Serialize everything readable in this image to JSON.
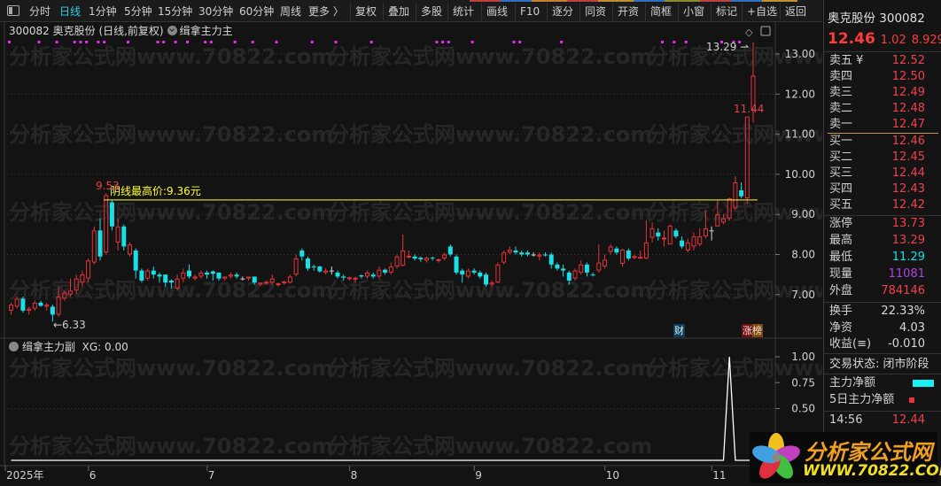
{
  "toolbar": {
    "periods": [
      "分时",
      "日线",
      "1分钟",
      "5分钟",
      "15分钟",
      "30分钟",
      "60分钟",
      "周线",
      "更多 〉"
    ],
    "active_period": "日线",
    "buttons": [
      "复权",
      "叠加",
      "多股",
      "统计",
      "画线",
      "F10",
      "逐分",
      "同资",
      "开资",
      "简框",
      "小窗",
      "标记",
      "+自选",
      "返回"
    ]
  },
  "chart_info": {
    "title": "300082 奥克股份 (日线,前复权)",
    "indicator": "缉拿主力主"
  },
  "indicator_panel": {
    "name": "缉拿主力副",
    "readout": "XG: 0.00"
  },
  "watermark": "分析家公式网www.70822.com",
  "badges": {
    "finance": "财",
    "limit_up_list": "涨榜"
  },
  "annotations": {
    "high_label": "9.53",
    "low_label": "6.33",
    "peak_label": "13.29",
    "last_open_label": "11.44",
    "bear_high_line_label": "阴线最高价:9.36元"
  },
  "colors": {
    "up": "#e8323c",
    "down": "#19e0e6",
    "flat": "#d8d8d8",
    "line": "#ffff33",
    "marker": "#e030e8",
    "bg": "#131313"
  },
  "chart_data": [
    {
      "type": "candlestick",
      "title": "300082 奥克股份 (日线,前复权)",
      "yticks": [
        "13.00",
        "12.00",
        "11.00",
        "10.00",
        "9.00",
        "8.00",
        "7.00"
      ],
      "ylim": [
        6.0,
        13.5
      ],
      "xticks": [
        {
          "label": "2025年",
          "index": 0
        },
        {
          "label": "6",
          "index": 14
        },
        {
          "label": "7",
          "index": 34
        },
        {
          "label": "8",
          "index": 58
        },
        {
          "label": "9",
          "index": 79
        },
        {
          "label": "10",
          "index": 101
        },
        {
          "label": "11",
          "index": 119
        }
      ],
      "hline": {
        "value": 9.36,
        "start_index": 16
      },
      "top_markers": [
        0,
        5,
        8,
        11,
        12,
        13,
        15,
        16,
        20,
        25,
        26,
        28,
        30,
        33,
        34,
        38,
        41,
        45,
        51,
        55,
        61,
        72,
        73,
        74,
        78,
        85,
        86,
        93,
        110,
        112,
        114,
        120,
        122,
        123
      ],
      "candles": [
        [
          6.6,
          6.8,
          6.5,
          6.75
        ],
        [
          6.7,
          6.95,
          6.65,
          6.9
        ],
        [
          6.9,
          6.95,
          6.55,
          6.6
        ],
        [
          6.6,
          6.7,
          6.5,
          6.65
        ],
        [
          6.65,
          6.85,
          6.6,
          6.8
        ],
        [
          6.8,
          6.85,
          6.7,
          6.72
        ],
        [
          6.7,
          6.8,
          6.6,
          6.75
        ],
        [
          6.7,
          6.75,
          6.33,
          6.5
        ],
        [
          6.5,
          7.2,
          6.45,
          6.95
        ],
        [
          6.9,
          7.1,
          6.85,
          7.05
        ],
        [
          7.0,
          7.4,
          6.95,
          7.1
        ],
        [
          7.1,
          7.5,
          7.0,
          7.4
        ],
        [
          7.3,
          7.6,
          7.2,
          7.5
        ],
        [
          7.4,
          7.9,
          7.3,
          7.85
        ],
        [
          7.8,
          8.7,
          7.75,
          8.6
        ],
        [
          8.6,
          8.9,
          7.85,
          7.95
        ],
        [
          8.05,
          9.53,
          8.0,
          9.48
        ],
        [
          9.3,
          9.36,
          8.6,
          8.7
        ],
        [
          8.3,
          8.9,
          8.1,
          8.7
        ],
        [
          8.7,
          8.75,
          8.1,
          8.2
        ],
        [
          8.0,
          8.3,
          7.95,
          8.25
        ],
        [
          8.1,
          8.15,
          7.4,
          7.6
        ],
        [
          7.6,
          7.65,
          7.3,
          7.35
        ],
        [
          7.4,
          7.65,
          7.35,
          7.6
        ],
        [
          7.6,
          7.7,
          7.4,
          7.5
        ],
        [
          7.5,
          7.55,
          7.3,
          7.45
        ],
        [
          7.5,
          7.5,
          7.2,
          7.3
        ],
        [
          7.35,
          7.38,
          7.15,
          7.3
        ],
        [
          7.15,
          7.5,
          7.1,
          7.4
        ],
        [
          7.4,
          7.65,
          7.3,
          7.55
        ],
        [
          7.6,
          7.75,
          7.4,
          7.45
        ],
        [
          7.4,
          7.5,
          7.35,
          7.45
        ],
        [
          7.45,
          7.6,
          7.4,
          7.55
        ],
        [
          7.55,
          7.6,
          7.4,
          7.5
        ],
        [
          7.58,
          7.6,
          7.35,
          7.52
        ],
        [
          7.55,
          7.55,
          7.35,
          7.4
        ],
        [
          7.4,
          7.45,
          7.35,
          7.45
        ],
        [
          7.45,
          7.55,
          7.4,
          7.5
        ],
        [
          7.5,
          7.55,
          7.4,
          7.45
        ],
        [
          7.4,
          7.45,
          7.35,
          7.4
        ],
        [
          7.4,
          7.45,
          7.35,
          7.45
        ],
        [
          7.45,
          7.45,
          7.25,
          7.3
        ],
        [
          7.25,
          7.3,
          7.2,
          7.3
        ],
        [
          7.3,
          7.35,
          7.25,
          7.32
        ],
        [
          7.3,
          7.5,
          7.25,
          7.4
        ],
        [
          7.25,
          7.3,
          7.2,
          7.28
        ],
        [
          7.28,
          7.35,
          7.25,
          7.33
        ],
        [
          7.3,
          7.5,
          7.28,
          7.45
        ],
        [
          7.5,
          8.0,
          7.45,
          7.9
        ],
        [
          8.1,
          8.15,
          7.85,
          7.95
        ],
        [
          7.9,
          7.95,
          7.6,
          7.65
        ],
        [
          7.7,
          7.75,
          7.6,
          7.68
        ],
        [
          7.7,
          7.72,
          7.55,
          7.58
        ],
        [
          7.55,
          7.65,
          7.5,
          7.6
        ],
        [
          7.6,
          7.7,
          7.5,
          7.6
        ],
        [
          7.55,
          7.6,
          7.4,
          7.45
        ],
        [
          7.45,
          7.5,
          7.35,
          7.42
        ],
        [
          7.4,
          7.45,
          7.35,
          7.43
        ],
        [
          7.38,
          7.45,
          7.3,
          7.42
        ],
        [
          7.48,
          7.5,
          7.4,
          7.45
        ],
        [
          7.45,
          7.6,
          7.4,
          7.55
        ],
        [
          7.5,
          7.55,
          7.4,
          7.45
        ],
        [
          7.45,
          7.7,
          7.4,
          7.62
        ],
        [
          7.62,
          7.65,
          7.5,
          7.55
        ],
        [
          7.55,
          7.8,
          7.5,
          7.7
        ],
        [
          7.7,
          8.0,
          7.65,
          7.95
        ],
        [
          7.72,
          8.5,
          7.7,
          8.1
        ],
        [
          7.95,
          8.1,
          7.9,
          7.97
        ],
        [
          7.95,
          8.0,
          7.85,
          7.9
        ],
        [
          7.92,
          7.95,
          7.82,
          7.88
        ],
        [
          7.85,
          7.95,
          7.8,
          7.92
        ],
        [
          7.92,
          7.95,
          7.85,
          7.9
        ],
        [
          7.85,
          7.9,
          7.8,
          7.88
        ],
        [
          7.9,
          8.05,
          7.85,
          8.0
        ],
        [
          8.2,
          8.25,
          7.95,
          8.0
        ],
        [
          7.95,
          8.0,
          7.5,
          7.55
        ],
        [
          7.6,
          7.65,
          7.3,
          7.5
        ],
        [
          7.45,
          7.65,
          7.4,
          7.6
        ],
        [
          7.6,
          7.65,
          7.5,
          7.55
        ],
        [
          7.55,
          7.6,
          7.4,
          7.45
        ],
        [
          7.5,
          7.55,
          7.2,
          7.25
        ],
        [
          7.25,
          7.35,
          7.2,
          7.3
        ],
        [
          7.3,
          7.8,
          7.28,
          7.75
        ],
        [
          7.8,
          8.1,
          7.75,
          8.05
        ],
        [
          8.05,
          8.2,
          8.0,
          8.12
        ],
        [
          8.1,
          8.2,
          8.0,
          8.05
        ],
        [
          8.05,
          8.1,
          7.95,
          8.0
        ],
        [
          8.05,
          8.1,
          7.95,
          8.0
        ],
        [
          8.0,
          8.05,
          7.95,
          8.0
        ],
        [
          7.95,
          8.05,
          7.85,
          8.0
        ],
        [
          8.0,
          8.05,
          7.95,
          7.98
        ],
        [
          8.0,
          8.05,
          7.65,
          7.75
        ],
        [
          7.75,
          7.8,
          7.6,
          7.65
        ],
        [
          7.65,
          7.75,
          7.45,
          7.6
        ],
        [
          7.55,
          7.6,
          7.25,
          7.35
        ],
        [
          7.4,
          7.65,
          7.35,
          7.6
        ],
        [
          7.55,
          7.85,
          7.5,
          7.75
        ],
        [
          7.75,
          7.8,
          7.45,
          7.55
        ],
        [
          7.5,
          7.55,
          7.45,
          7.48
        ],
        [
          7.6,
          8.25,
          7.55,
          7.8
        ],
        [
          7.7,
          8.0,
          7.65,
          7.87
        ],
        [
          8.07,
          8.25,
          8.0,
          8.2
        ],
        [
          8.15,
          8.2,
          8.0,
          8.05
        ],
        [
          7.77,
          8.15,
          7.7,
          8.12
        ],
        [
          8.1,
          8.15,
          7.85,
          7.9
        ],
        [
          7.92,
          8.0,
          7.88,
          7.96
        ],
        [
          7.93,
          8.1,
          7.9,
          7.94
        ],
        [
          7.9,
          8.85,
          7.88,
          8.3
        ],
        [
          8.42,
          8.8,
          8.3,
          8.65
        ],
        [
          8.55,
          8.65,
          8.35,
          8.45
        ],
        [
          8.4,
          8.6,
          8.2,
          8.42
        ],
        [
          8.25,
          8.75,
          8.25,
          8.72
        ],
        [
          8.6,
          8.65,
          8.4,
          8.45
        ],
        [
          8.35,
          8.45,
          8.15,
          8.2
        ],
        [
          8.1,
          8.4,
          8.05,
          8.3
        ],
        [
          8.2,
          8.55,
          8.1,
          8.45
        ],
        [
          8.25,
          8.65,
          8.2,
          8.45
        ],
        [
          8.45,
          9.1,
          8.4,
          8.65
        ],
        [
          8.6,
          8.7,
          8.35,
          8.6
        ],
        [
          8.7,
          9.35,
          8.7,
          9.0
        ],
        [
          8.8,
          9.0,
          8.75,
          8.9
        ],
        [
          8.9,
          9.42,
          8.85,
          9.4
        ],
        [
          9.15,
          9.95,
          9.1,
          9.8
        ],
        [
          9.6,
          9.8,
          9.4,
          9.45
        ],
        [
          9.4,
          11.44,
          9.25,
          11.44
        ],
        [
          11.6,
          13.29,
          11.29,
          12.46
        ]
      ]
    },
    {
      "type": "line",
      "title": "缉拿主力副",
      "series": [
        {
          "name": "XG",
          "spike_indices": [
            121
          ],
          "spike_value": 1,
          "base_value": 0
        }
      ],
      "yticks": [
        "1.00",
        "0.75",
        "0.50"
      ],
      "ylim": [
        0,
        1
      ]
    }
  ],
  "panel": {
    "name_code": "奥克股份 300082",
    "price": "12.46",
    "change": "1.02",
    "change_pct": "8.929",
    "asks": [
      {
        "label": "卖五 ¥",
        "price": "12.52"
      },
      {
        "label": "卖四",
        "price": "12.50"
      },
      {
        "label": "卖三",
        "price": "12.49"
      },
      {
        "label": "卖二",
        "price": "12.48"
      },
      {
        "label": "卖一",
        "price": "12.47"
      }
    ],
    "bids": [
      {
        "label": "买一",
        "price": "12.46"
      },
      {
        "label": "买二",
        "price": "12.45"
      },
      {
        "label": "买三",
        "price": "12.44"
      },
      {
        "label": "买四",
        "price": "12.43"
      },
      {
        "label": "买五",
        "price": "12.42"
      }
    ],
    "stats": [
      {
        "label": "涨停",
        "value": "13.73",
        "color": "#f0404c"
      },
      {
        "label": "最高",
        "value": "13.29",
        "color": "#f0404c"
      },
      {
        "label": "最低",
        "value": "11.29",
        "color": "#19e0e6"
      },
      {
        "label": "现量",
        "value": "11081",
        "color": "#b040e0"
      },
      {
        "label": "外盘",
        "value": "784146",
        "color": "#f0404c"
      }
    ],
    "stats2": [
      {
        "label": "换手",
        "value": "22.33%"
      },
      {
        "label": "净资",
        "value": "4.03"
      },
      {
        "label": "收益(≡)",
        "value": "-0.010"
      }
    ],
    "status": "交易状态: 闭市阶段",
    "legend": [
      {
        "label": "主力净额",
        "color": "#19f0f0"
      },
      {
        "label": "5日主力净额",
        "color": "#f0303c"
      }
    ],
    "ticks": [
      {
        "time": "14:56",
        "price": "12.44"
      }
    ]
  },
  "logo": {
    "text": "分析家公式网",
    "url": "WWW.70822.COM"
  }
}
